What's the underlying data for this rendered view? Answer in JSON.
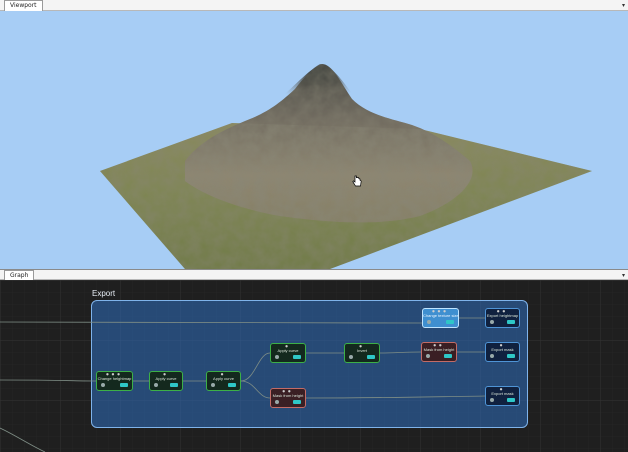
{
  "viewport": {
    "tab_label": "Viewport",
    "menu_icon": "chevron-down-icon"
  },
  "graph": {
    "tab_label": "Graph",
    "menu_icon": "chevron-down-icon",
    "group_title": "Export",
    "nodes": [
      {
        "id": "change-heightmap",
        "label": "Change heightmap",
        "style": "green"
      },
      {
        "id": "apply-curve-1",
        "label": "Apply curve",
        "style": "green"
      },
      {
        "id": "apply-curve-2",
        "label": "Apply curve",
        "style": "green"
      },
      {
        "id": "apply-curve-3",
        "label": "Apply curve",
        "style": "green"
      },
      {
        "id": "invert",
        "label": "Invert",
        "style": "green"
      },
      {
        "id": "mask-from-height-1",
        "label": "Mask from height",
        "style": "red"
      },
      {
        "id": "mask-from-height-2",
        "label": "Mask from height",
        "style": "red"
      },
      {
        "id": "change-texture-size",
        "label": "Change texture size",
        "style": "selected"
      },
      {
        "id": "export-heightmap",
        "label": "Export heightmap",
        "style": "blue"
      },
      {
        "id": "export-mask-1",
        "label": "Export mask",
        "style": "blue"
      },
      {
        "id": "export-mask-2",
        "label": "Export mask",
        "style": "blue"
      }
    ]
  },
  "colors": {
    "sky": "#a7cdf5",
    "graph_bg": "#1f1f1f",
    "group_fill": "#2d6ebe",
    "node_green_border": "#3cb047",
    "node_red_border": "#c36b66",
    "node_blue_border": "#4f94d6"
  }
}
